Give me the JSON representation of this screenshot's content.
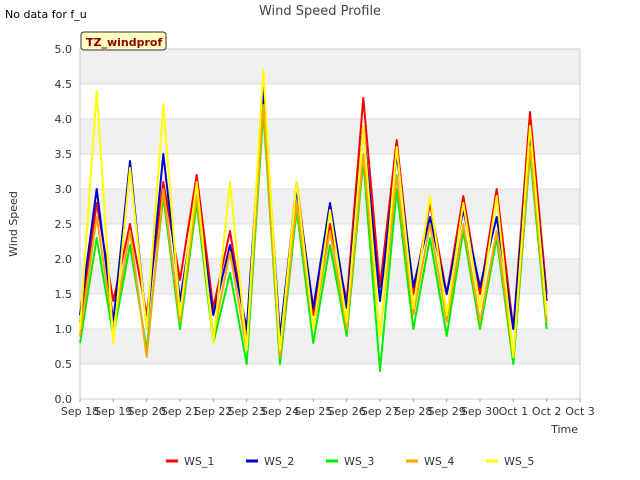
{
  "note": "No data for f_u",
  "chart_data": {
    "type": "line",
    "title": "Wind Speed Profile",
    "xlabel": "Time",
    "ylabel": "Wind Speed",
    "badge": "TZ_windprof",
    "ylim": [
      0.0,
      5.0
    ],
    "yticks": [
      "0.0",
      "0.5",
      "1.0",
      "1.5",
      "2.0",
      "2.5",
      "3.0",
      "3.5",
      "4.0",
      "4.5",
      "5.0"
    ],
    "xlim": [
      "2023-09-18",
      "2023-10-03"
    ],
    "xticks": [
      "Sep 18",
      "Sep 19",
      "Sep 20",
      "Sep 21",
      "Sep 22",
      "Sep 23",
      "Sep 24",
      "Sep 25",
      "Sep 26",
      "Sep 27",
      "Sep 28",
      "Sep 29",
      "Sep 30",
      "Oct 1",
      "Oct 2",
      "Oct 3"
    ],
    "grid": true,
    "legend": "bottom",
    "x": [
      "2023-09-18",
      "2023-09-18 12:00",
      "2023-09-19",
      "2023-09-19 12:00",
      "2023-09-20",
      "2023-09-20 12:00",
      "2023-09-21",
      "2023-09-21 12:00",
      "2023-09-22",
      "2023-09-22 12:00",
      "2023-09-23",
      "2023-09-23 12:00",
      "2023-09-24",
      "2023-09-24 12:00",
      "2023-09-25",
      "2023-09-25 12:00",
      "2023-09-26",
      "2023-09-26 12:00",
      "2023-09-27",
      "2023-09-27 12:00",
      "2023-09-28",
      "2023-09-28 12:00",
      "2023-09-29",
      "2023-09-29 12:00",
      "2023-09-30",
      "2023-09-30 12:00",
      "2023-10-01",
      "2023-10-01 12:00",
      "2023-10-02"
    ],
    "series": [
      {
        "name": "WS_1",
        "color": "#ff0000",
        "values": [
          1.1,
          2.8,
          1.4,
          2.5,
          1.2,
          3.1,
          1.7,
          3.2,
          1.3,
          2.4,
          0.9,
          4.5,
          0.8,
          3.1,
          1.2,
          2.5,
          1.4,
          4.3,
          1.6,
          3.7,
          1.5,
          2.8,
          1.5,
          2.9,
          1.5,
          3.0,
          1.0,
          4.1,
          1.5
        ]
      },
      {
        "name": "WS_2",
        "color": "#0000cc",
        "values": [
          1.2,
          3.0,
          1.1,
          3.4,
          1.0,
          3.5,
          1.4,
          2.9,
          1.2,
          2.2,
          1.0,
          4.4,
          0.9,
          3.0,
          1.3,
          2.8,
          1.3,
          3.9,
          1.4,
          3.5,
          1.6,
          2.6,
          1.5,
          2.7,
          1.6,
          2.6,
          1.0,
          3.8,
          1.4
        ]
      },
      {
        "name": "WS_3",
        "color": "#00ee00",
        "values": [
          0.8,
          2.3,
          0.9,
          2.2,
          0.7,
          2.9,
          1.0,
          2.8,
          0.8,
          1.8,
          0.5,
          4.1,
          0.5,
          2.7,
          0.8,
          2.2,
          0.9,
          3.4,
          0.4,
          3.0,
          1.0,
          2.3,
          0.9,
          2.4,
          1.0,
          2.3,
          0.5,
          3.5,
          1.0
        ]
      },
      {
        "name": "WS_4",
        "color": "#ffa500",
        "values": [
          0.9,
          2.6,
          1.0,
          2.4,
          0.6,
          3.0,
          1.1,
          2.9,
          0.9,
          2.1,
          0.7,
          4.2,
          0.6,
          2.8,
          1.0,
          2.4,
          1.0,
          3.5,
          0.9,
          3.2,
          1.2,
          2.5,
          1.1,
          2.5,
          1.1,
          2.4,
          0.6,
          3.6,
          1.1
        ]
      },
      {
        "name": "WS_5",
        "color": "#ffff00",
        "values": [
          1.0,
          4.4,
          0.8,
          3.3,
          1.0,
          4.2,
          1.2,
          3.1,
          0.8,
          3.1,
          0.7,
          4.7,
          0.7,
          3.1,
          1.0,
          2.7,
          1.1,
          3.9,
          0.9,
          3.6,
          1.3,
          2.9,
          1.2,
          2.8,
          1.3,
          2.9,
          0.6,
          3.9,
          1.2
        ]
      }
    ]
  }
}
